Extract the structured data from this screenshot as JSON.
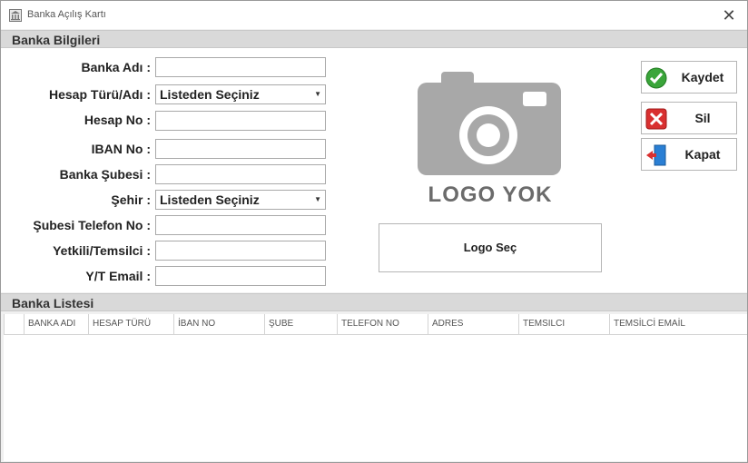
{
  "window": {
    "title": "Banka Açılış Kartı"
  },
  "sections": {
    "info": "Banka Bilgileri",
    "list": "Banka Listesi"
  },
  "form": {
    "bank_name_label": "Banka Adı :",
    "account_type_label": "Hesap Türü/Adı :",
    "account_type_value": "Listeden Seçiniz",
    "account_no_label": "Hesap No :",
    "iban_label": "IBAN No :",
    "branch_label": "Banka Şubesi :",
    "city_label": "Şehir :",
    "city_value": "Listeden Seçiniz",
    "branch_phone_label": "Şubesi Telefon No :",
    "rep_label": "Yetkili/Temsilci :",
    "rep_email_label": "Y/T Email :"
  },
  "logo": {
    "placeholder_text": "LOGO YOK",
    "select_label": "Logo Seç"
  },
  "actions": {
    "save": "Kaydet",
    "delete": "Sil",
    "close": "Kapat"
  },
  "grid": {
    "columns": [
      "BANKA ADI",
      "HESAP TÜRÜ",
      "İBAN NO",
      "ŞUBE",
      "TELEFON NO",
      "ADRES",
      "TEMSILCI",
      "TEMSİLCİ EMAİL"
    ]
  },
  "colors": {
    "section_bg": "#d9d9d9",
    "logo_gray": "#a8a8a8",
    "save_green": "#3aa53a",
    "delete_red": "#d93030",
    "exit_blue": "#2a7fd4"
  }
}
